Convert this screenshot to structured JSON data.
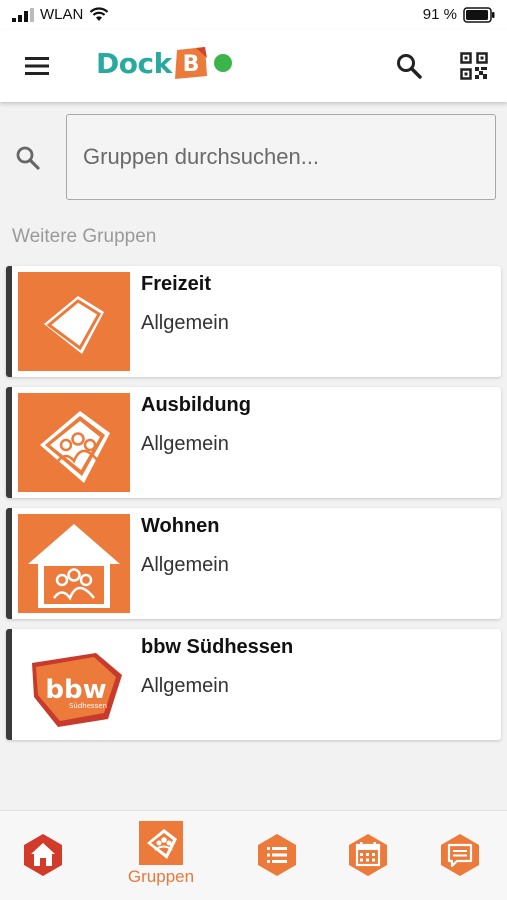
{
  "status_bar": {
    "carrier": "WLAN",
    "battery": "91 %"
  },
  "app": {
    "logo_text": "Dock",
    "logo_letter": "B"
  },
  "search": {
    "placeholder": "Gruppen durchsuchen..."
  },
  "section": {
    "title": "Weitere Gruppen"
  },
  "groups": [
    {
      "name": "Freizeit",
      "category": "Allgemein",
      "icon": "diamond-icon"
    },
    {
      "name": "Ausbildung",
      "category": "Allgemein",
      "icon": "people-diamond-icon"
    },
    {
      "name": "Wohnen",
      "category": "Allgemein",
      "icon": "house-people-icon"
    },
    {
      "name": "bbw Südhessen",
      "category": "Allgemein",
      "icon": "bbw-logo",
      "logo_text": "bbw",
      "logo_subtext": "Südhessen"
    }
  ],
  "bottom_nav": {
    "items": [
      {
        "id": "home",
        "icon": "home-icon"
      },
      {
        "id": "groups",
        "icon": "groups-icon",
        "label": "Gruppen",
        "active": true
      },
      {
        "id": "list",
        "icon": "list-icon"
      },
      {
        "id": "calendar",
        "icon": "calendar-icon"
      },
      {
        "id": "chat",
        "icon": "chat-icon"
      }
    ]
  },
  "colors": {
    "brand_orange": "#ec7a3a",
    "brand_teal": "#2aa9a0",
    "online_green": "#3bb54a",
    "home_red": "#d23a2a"
  }
}
